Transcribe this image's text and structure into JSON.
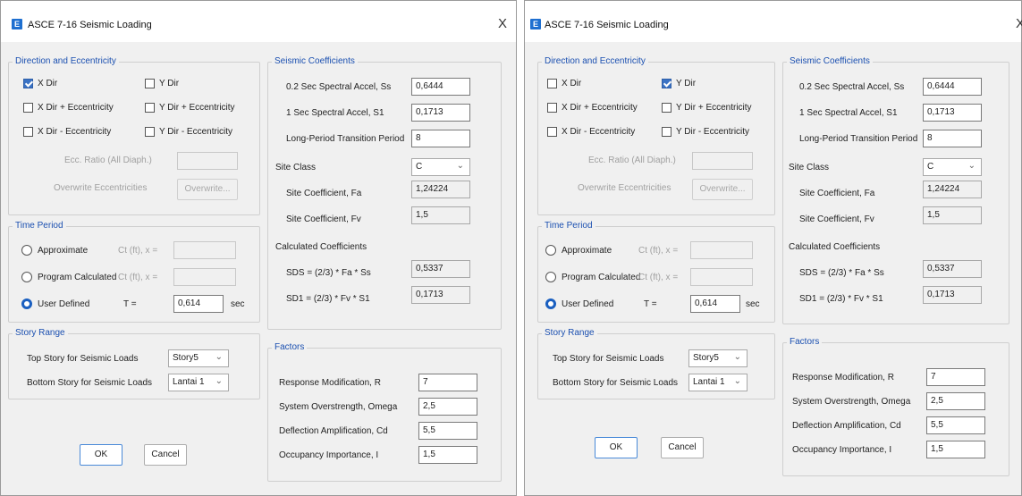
{
  "window_title": "ASCE 7-16 Seismic Loading",
  "close_glyph": "X",
  "app_icon_letter": "E",
  "direction": {
    "title": "Direction and Eccentricity",
    "x_dir": "X Dir",
    "y_dir": "Y Dir",
    "x_dir_plus": "X Dir + Eccentricity",
    "y_dir_plus": "Y Dir + Eccentricity",
    "x_dir_minus": "X Dir - Eccentricity",
    "y_dir_minus": "Y Dir - Eccentricity",
    "ecc_ratio_label": "Ecc. Ratio (All Diaph.)",
    "overwrite_label": "Overwrite Eccentricities",
    "overwrite_button": "Overwrite..."
  },
  "time_period": {
    "title": "Time Period",
    "approximate": "Approximate",
    "program_calculated": "Program Calculated",
    "user_defined": "User Defined",
    "ct_label": "Ct (ft), x =",
    "t_label": "T =",
    "t_value": "0,614",
    "t_unit": "sec"
  },
  "story_range": {
    "title": "Story Range",
    "top_label": "Top Story for Seismic Loads",
    "top_value": "Story5",
    "bottom_label": "Bottom Story for Seismic Loads",
    "bottom_value": "Lantai 1"
  },
  "buttons": {
    "ok": "OK",
    "cancel": "Cancel"
  },
  "seismic": {
    "title": "Seismic Coefficients",
    "ss_label": "0.2 Sec Spectral Accel, Ss",
    "ss_value": "0,6444",
    "s1_label": "1 Sec Spectral Accel, S1",
    "s1_value": "0,1713",
    "tl_label": "Long-Period Transition Period",
    "tl_value": "8",
    "site_class_label": "Site Class",
    "site_class_value": "C",
    "fa_label": "Site Coefficient, Fa",
    "fa_value": "1,24224",
    "fv_label": "Site Coefficient, Fv",
    "fv_value": "1,5",
    "calc_title": "Calculated Coefficients",
    "sds_label": "SDS = (2/3) * Fa * Ss",
    "sds_value": "0,5337",
    "sd1_label": "SD1 = (2/3) * Fv * S1",
    "sd1_value": "0,1713"
  },
  "factors": {
    "title": "Factors",
    "r_label": "Response Modification, R",
    "r_value": "7",
    "omega_label": "System Overstrength, Omega",
    "omega_value": "2,5",
    "cd_label": "Deflection Amplification, Cd",
    "cd_value": "5,5",
    "i_label": "Occupancy Importance, I",
    "i_value": "1,5"
  },
  "dialogs": [
    {
      "x_dir_checked": true,
      "y_dir_checked": false
    },
    {
      "x_dir_checked": false,
      "y_dir_checked": true
    }
  ],
  "colors": {
    "accent": "#1a5fc0",
    "group_title": "#1a4fb0"
  }
}
